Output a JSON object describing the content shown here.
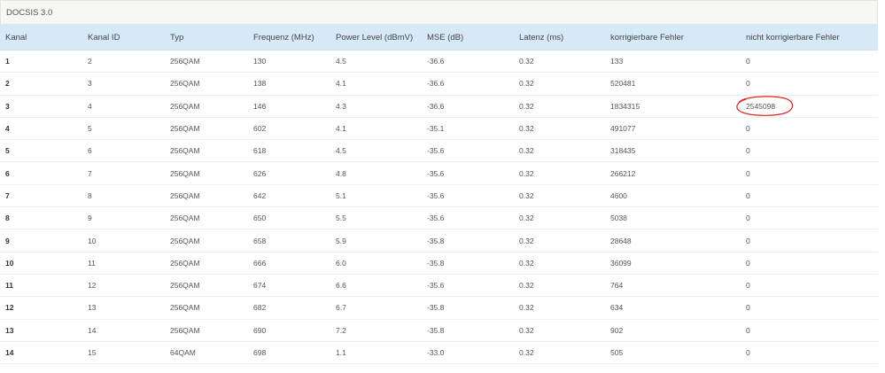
{
  "section": {
    "title": "DOCSIS 3.0"
  },
  "table": {
    "headers": [
      "Kanal",
      "Kanal ID",
      "Typ",
      "Frequenz (MHz)",
      "Power Level (dBmV)",
      "MSE (dB)",
      "Latenz (ms)",
      "korrigierbare Fehler",
      "nicht korrigierbare Fehler"
    ],
    "rows": [
      [
        "1",
        "2",
        "256QAM",
        "130",
        "4.5",
        "-36.6",
        "0.32",
        "133",
        "0"
      ],
      [
        "2",
        "3",
        "256QAM",
        "138",
        "4.1",
        "-36.6",
        "0.32",
        "520481",
        "0"
      ],
      [
        "3",
        "4",
        "256QAM",
        "146",
        "4.3",
        "-36.6",
        "0.32",
        "1834315",
        "2545098"
      ],
      [
        "4",
        "5",
        "256QAM",
        "602",
        "4.1",
        "-35.1",
        "0.32",
        "491077",
        "0"
      ],
      [
        "5",
        "6",
        "256QAM",
        "618",
        "4.5",
        "-35.6",
        "0.32",
        "318435",
        "0"
      ],
      [
        "6",
        "7",
        "256QAM",
        "626",
        "4.8",
        "-35.6",
        "0.32",
        "266212",
        "0"
      ],
      [
        "7",
        "8",
        "256QAM",
        "642",
        "5.1",
        "-35.6",
        "0.32",
        "4600",
        "0"
      ],
      [
        "8",
        "9",
        "256QAM",
        "650",
        "5.5",
        "-35.6",
        "0.32",
        "5038",
        "0"
      ],
      [
        "9",
        "10",
        "256QAM",
        "658",
        "5.9",
        "-35.8",
        "0.32",
        "28648",
        "0"
      ],
      [
        "10",
        "11",
        "256QAM",
        "666",
        "6.0",
        "-35.8",
        "0.32",
        "36099",
        "0"
      ],
      [
        "11",
        "12",
        "256QAM",
        "674",
        "6.6",
        "-35.6",
        "0.32",
        "764",
        "0"
      ],
      [
        "12",
        "13",
        "256QAM",
        "682",
        "6.7",
        "-35.8",
        "0.32",
        "634",
        "0"
      ],
      [
        "13",
        "14",
        "256QAM",
        "690",
        "7.2",
        "-35.8",
        "0.32",
        "902",
        "0"
      ],
      [
        "14",
        "15",
        "64QAM",
        "698",
        "1.1",
        "-33.0",
        "0.32",
        "505",
        "0"
      ]
    ]
  },
  "annotation": {
    "color": "#e02020",
    "icon": "red-hand-drawn-circle-icon"
  },
  "colors": {
    "header_bg": "#d6e9f7",
    "section_bg": "#f7f7f5"
  }
}
